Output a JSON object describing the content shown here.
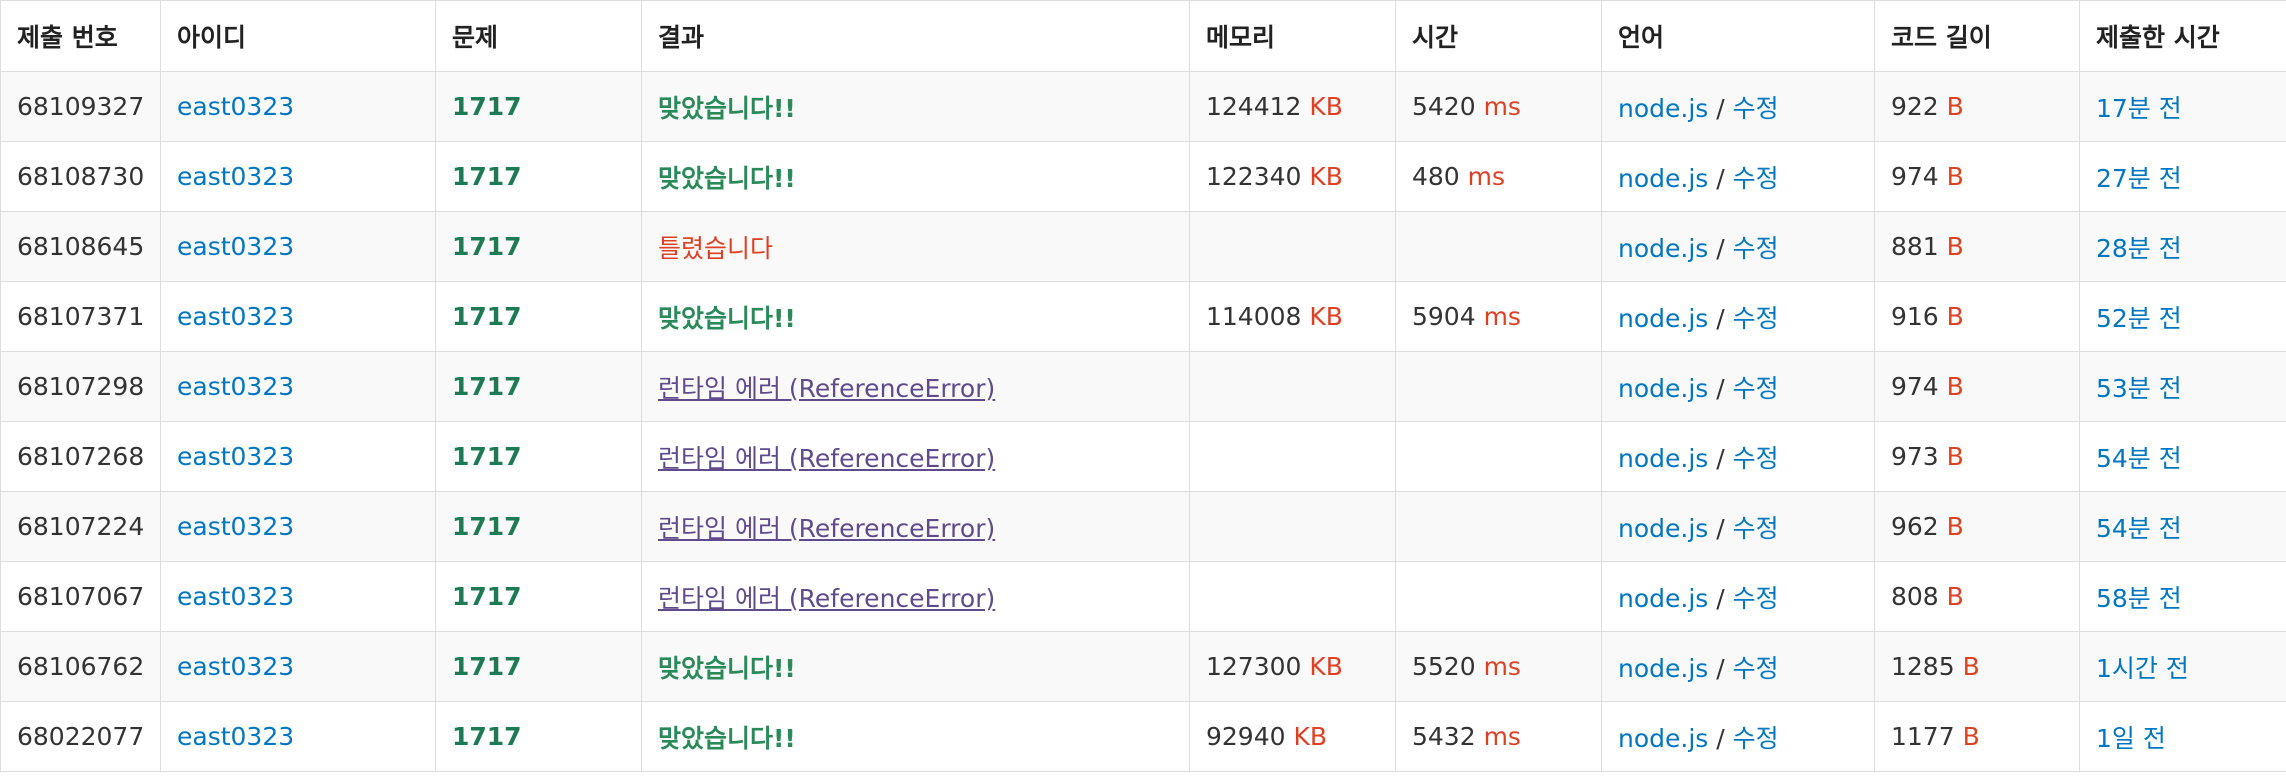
{
  "columns": [
    "제출 번호",
    "아이디",
    "문제",
    "결과",
    "메모리",
    "시간",
    "언어",
    "코드 길이",
    "제출한 시간"
  ],
  "memory_unit": "KB",
  "time_unit": "ms",
  "length_unit": "B",
  "separator": "/",
  "colors": {
    "link": "#0076c0",
    "accepted": "#2b8a5a",
    "wrong": "#dd4124",
    "runtime_error": "#5f4b8b",
    "unit": "#dd4124",
    "row_stripe": "#f9f9f9",
    "border": "#dddddd"
  },
  "rows": [
    {
      "id": "68109327",
      "user": "east0323",
      "problem": "1717",
      "result": "맞았습니다!!",
      "result_type": "ac",
      "memory": "124412",
      "time": "5420",
      "lang": "node.js",
      "edit": "수정",
      "length": "922",
      "submitted": "17분 전"
    },
    {
      "id": "68108730",
      "user": "east0323",
      "problem": "1717",
      "result": "맞았습니다!!",
      "result_type": "ac",
      "memory": "122340",
      "time": "480",
      "lang": "node.js",
      "edit": "수정",
      "length": "974",
      "submitted": "27분 전"
    },
    {
      "id": "68108645",
      "user": "east0323",
      "problem": "1717",
      "result": "틀렸습니다",
      "result_type": "wa",
      "memory": "",
      "time": "",
      "lang": "node.js",
      "edit": "수정",
      "length": "881",
      "submitted": "28분 전"
    },
    {
      "id": "68107371",
      "user": "east0323",
      "problem": "1717",
      "result": "맞았습니다!!",
      "result_type": "ac",
      "memory": "114008",
      "time": "5904",
      "lang": "node.js",
      "edit": "수정",
      "length": "916",
      "submitted": "52분 전"
    },
    {
      "id": "68107298",
      "user": "east0323",
      "problem": "1717",
      "result": "런타임 에러 (ReferenceError)",
      "result_type": "rte",
      "memory": "",
      "time": "",
      "lang": "node.js",
      "edit": "수정",
      "length": "974",
      "submitted": "53분 전"
    },
    {
      "id": "68107268",
      "user": "east0323",
      "problem": "1717",
      "result": "런타임 에러 (ReferenceError)",
      "result_type": "rte",
      "memory": "",
      "time": "",
      "lang": "node.js",
      "edit": "수정",
      "length": "973",
      "submitted": "54분 전"
    },
    {
      "id": "68107224",
      "user": "east0323",
      "problem": "1717",
      "result": "런타임 에러 (ReferenceError)",
      "result_type": "rte",
      "memory": "",
      "time": "",
      "lang": "node.js",
      "edit": "수정",
      "length": "962",
      "submitted": "54분 전"
    },
    {
      "id": "68107067",
      "user": "east0323",
      "problem": "1717",
      "result": "런타임 에러 (ReferenceError)",
      "result_type": "rte",
      "memory": "",
      "time": "",
      "lang": "node.js",
      "edit": "수정",
      "length": "808",
      "submitted": "58분 전"
    },
    {
      "id": "68106762",
      "user": "east0323",
      "problem": "1717",
      "result": "맞았습니다!!",
      "result_type": "ac",
      "memory": "127300",
      "time": "5520",
      "lang": "node.js",
      "edit": "수정",
      "length": "1285",
      "submitted": "1시간 전"
    },
    {
      "id": "68022077",
      "user": "east0323",
      "problem": "1717",
      "result": "맞았습니다!!",
      "result_type": "ac",
      "memory": "92940",
      "time": "5432",
      "lang": "node.js",
      "edit": "수정",
      "length": "1177",
      "submitted": "1일 전"
    }
  ]
}
